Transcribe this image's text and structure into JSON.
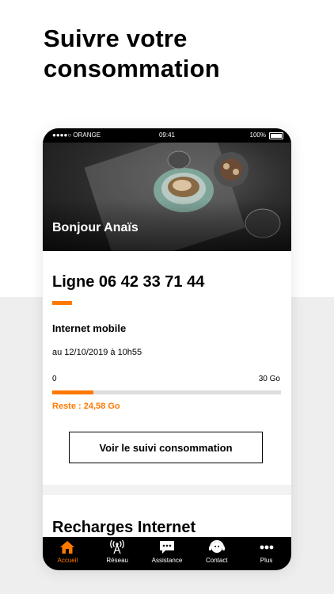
{
  "headline": {
    "line1": "Suivre votre",
    "line2": "consommation"
  },
  "statusbar": {
    "carrier": "●●●●○ ORANGE",
    "time": "09:41",
    "battery": "100%"
  },
  "hero": {
    "greeting": "Bonjour Anaïs"
  },
  "line": {
    "title": "Ligne 06 42 33 71 44",
    "section": "Internet mobile",
    "date": "au 12/10/2019 à 10h55",
    "min": "0",
    "max": "30 Go",
    "remaining": "Reste : 24,58 Go",
    "used_fraction": 0.18,
    "cta": "Voir le suivi consommation"
  },
  "recharges": {
    "title": "Recharges Internet"
  },
  "tabs": [
    {
      "label": "Accueil",
      "icon": "home-icon",
      "active": true
    },
    {
      "label": "Réseau",
      "icon": "antenna-icon",
      "active": false
    },
    {
      "label": "Assistance",
      "icon": "chat-icon",
      "active": false
    },
    {
      "label": "Contact",
      "icon": "headset-icon",
      "active": false
    },
    {
      "label": "Plus",
      "icon": "more-icon",
      "active": false
    }
  ],
  "colors": {
    "accent": "#ff7900",
    "tabbar": "#000000",
    "track": "#dddddd",
    "background_lower": "#eeeeee"
  }
}
